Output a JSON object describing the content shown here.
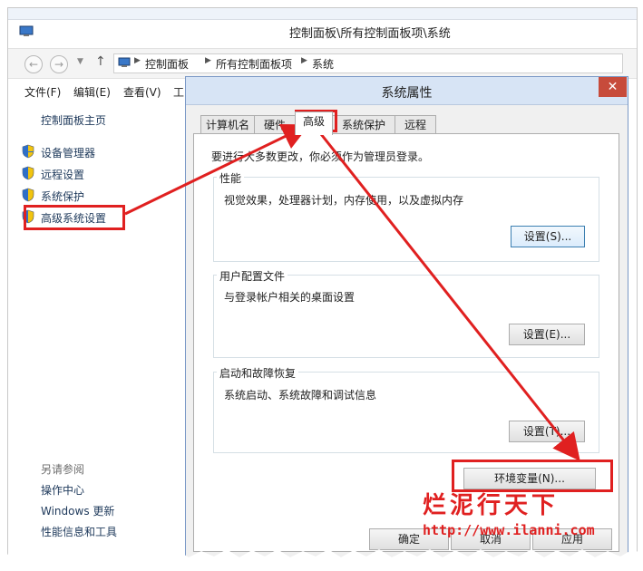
{
  "window": {
    "title": "控制面板\\所有控制面板项\\系统",
    "breadcrumbs": [
      "控制面板",
      "所有控制面板项",
      "系统"
    ]
  },
  "nav": {
    "back": "←",
    "forward": "→",
    "up": "↑"
  },
  "menu": [
    "文件(F)",
    "编辑(E)",
    "查看(V)",
    "工"
  ],
  "sidebar": {
    "home": "控制面板主页",
    "links": [
      "设备管理器",
      "远程设置",
      "系统保护",
      "高级系统设置"
    ],
    "see_also_title": "另请参阅",
    "see_also": [
      "操作中心",
      "Windows 更新",
      "性能信息和工具"
    ]
  },
  "dialog": {
    "title": "系统属性",
    "close": "✕",
    "tabs": [
      "计算机名",
      "硬件",
      "高级",
      "系统保护",
      "远程"
    ],
    "active_tab": "高级",
    "admin_note": "要进行大多数更改，你必须作为管理员登录。",
    "groups": [
      {
        "title": "性能",
        "desc": "视觉效果，处理器计划，内存使用，以及虚拟内存",
        "button": "设置(S)..."
      },
      {
        "title": "用户配置文件",
        "desc": "与登录帐户相关的桌面设置",
        "button": "设置(E)..."
      },
      {
        "title": "启动和故障恢复",
        "desc": "系统启动、系统故障和调试信息",
        "button": "设置(T)..."
      }
    ],
    "env_button": "环境变量(N)...",
    "ok": "确定",
    "cancel": "取消",
    "apply": "应用"
  },
  "watermark": {
    "brand": "烂泥行天下",
    "url": "http://www.ilanni.com"
  },
  "colors": {
    "highlight": "#e02020",
    "link": "#1e395b",
    "dialog_bg": "#f0f0f0"
  }
}
